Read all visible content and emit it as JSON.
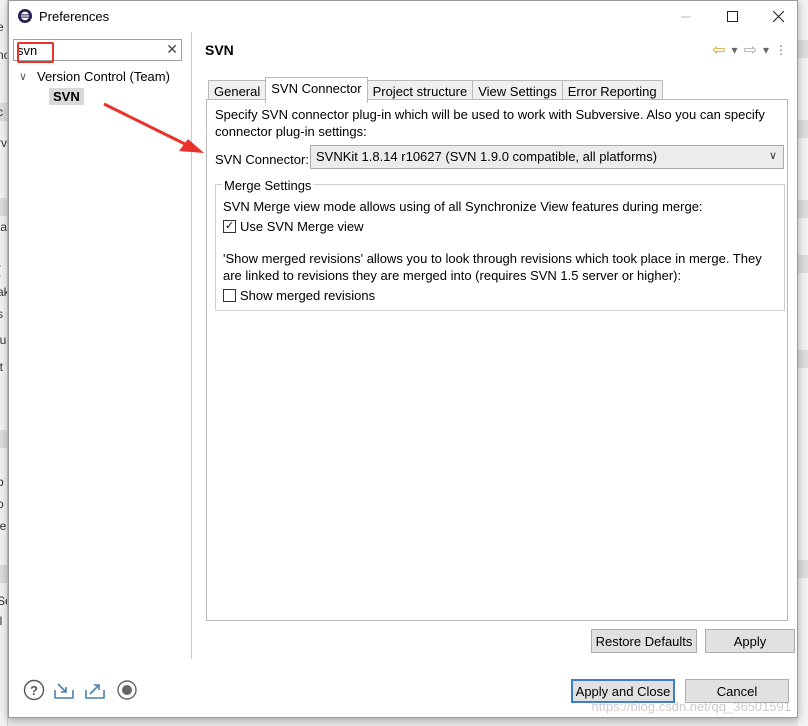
{
  "window": {
    "title": "Preferences"
  },
  "filter": {
    "value": "svn"
  },
  "tree": {
    "root": "Version Control (Team)",
    "child": "SVN"
  },
  "page": {
    "title": "SVN"
  },
  "tabs": [
    "General",
    "SVN Connector",
    "Project structure",
    "View Settings",
    "Error Reporting"
  ],
  "connector": {
    "description": "Specify SVN connector plug-in which will be used to work with Subversive. Also you can specify connector plug-in settings:",
    "label": "SVN Connector:",
    "selected": "SVNKit 1.8.14 r10627 (SVN 1.9.0 compatible, all platforms)"
  },
  "merge": {
    "legend": "Merge Settings",
    "text1": "SVN Merge view mode allows using of all Synchronize View features during merge:",
    "cb1_label": "Use SVN Merge view",
    "cb1_checked": true,
    "text2": "'Show merged revisions' allows you to look through revisions which took place in merge. They are linked to revisions they are merged into (requires SVN 1.5 server or higher):",
    "cb2_label": "Show merged revisions",
    "cb2_checked": false
  },
  "buttons": {
    "restore": "Restore Defaults",
    "apply": "Apply",
    "apply_close": "Apply and Close",
    "cancel": "Cancel"
  },
  "watermark": "https://blog.csdn.net/qq_36501591",
  "bg_fragments": [
    "e",
    "nc",
    "c",
    "rv",
    "ta",
    "(",
    "ak",
    "s",
    "lu",
    "lt",
    "b",
    "o",
    "le",
    "Se",
    "ll"
  ],
  "colors": {
    "highlight_red": "#e8322a",
    "default_button_border": "#3c7fd1",
    "selected_tree_bg": "#d9d9d9"
  },
  "icons": [
    "app-icon",
    "clear-filter-icon",
    "back-icon",
    "forward-icon",
    "menu-icon",
    "help-icon",
    "import-icon",
    "export-icon",
    "record-icon"
  ]
}
